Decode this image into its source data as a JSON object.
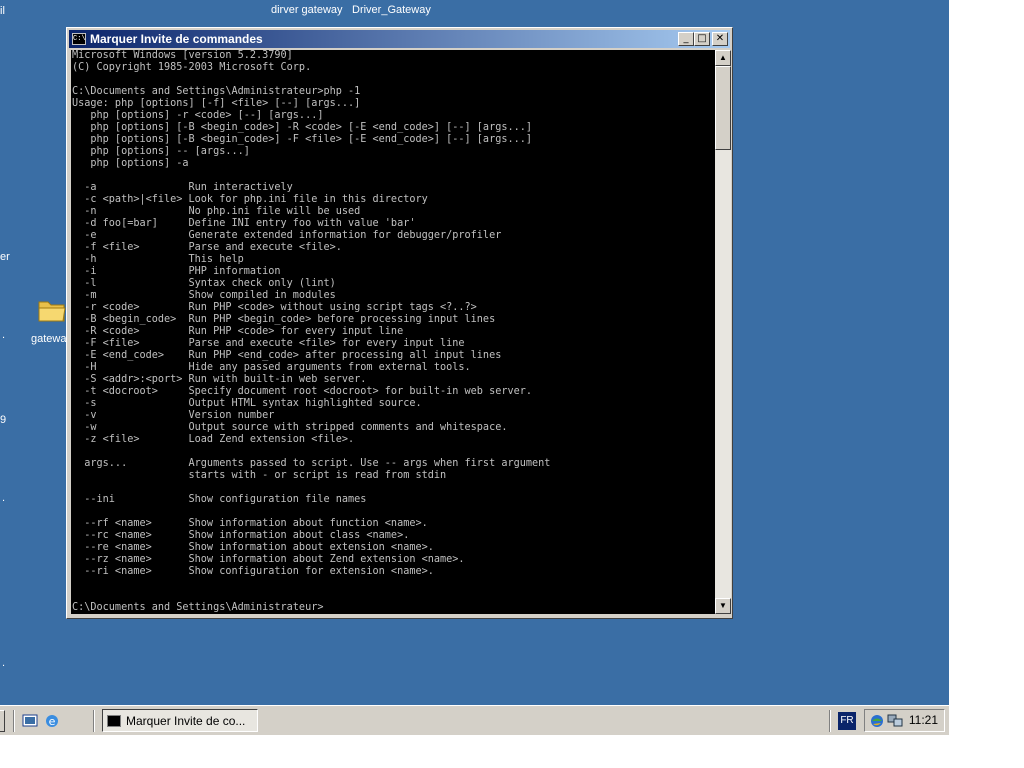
{
  "desktop": {
    "top_labels": [
      "dirver gateway",
      "Driver_Gateway"
    ],
    "edge_labels": [
      "il",
      "er",
      ".",
      "9",
      ".",
      "."
    ],
    "folder_label": "gatewa",
    "background_color": "#3a6ea5"
  },
  "window": {
    "title": "Marquer Invite de commandes",
    "icon_text": "C:\\",
    "buttons": {
      "minimize": "_",
      "maximize": "□",
      "close": "✕"
    },
    "console_lines": [
      "Microsoft Windows [version 5.2.3790]",
      "(C) Copyright 1985-2003 Microsoft Corp.",
      "",
      "C:\\Documents and Settings\\Administrateur>php -1",
      "Usage: php [options] [-f] <file> [--] [args...]",
      "   php [options] -r <code> [--] [args...]",
      "   php [options] [-B <begin_code>] -R <code> [-E <end_code>] [--] [args...]",
      "   php [options] [-B <begin_code>] -F <file> [-E <end_code>] [--] [args...]",
      "   php [options] -- [args...]",
      "   php [options] -a",
      "",
      "  -a               Run interactively",
      "  -c <path>|<file> Look for php.ini file in this directory",
      "  -n               No php.ini file will be used",
      "  -d foo[=bar]     Define INI entry foo with value 'bar'",
      "  -e               Generate extended information for debugger/profiler",
      "  -f <file>        Parse and execute <file>.",
      "  -h               This help",
      "  -i               PHP information",
      "  -l               Syntax check only (lint)",
      "  -m               Show compiled in modules",
      "  -r <code>        Run PHP <code> without using script tags <?..?>",
      "  -B <begin_code>  Run PHP <begin_code> before processing input lines",
      "  -R <code>        Run PHP <code> for every input line",
      "  -F <file>        Parse and execute <file> for every input line",
      "  -E <end_code>    Run PHP <end_code> after processing all input lines",
      "  -H               Hide any passed arguments from external tools.",
      "  -S <addr>:<port> Run with built-in web server.",
      "  -t <docroot>     Specify document root <docroot> for built-in web server.",
      "  -s               Output HTML syntax highlighted source.",
      "  -v               Version number",
      "  -w               Output source with stripped comments and whitespace.",
      "  -z <file>        Load Zend extension <file>.",
      "",
      "  args...          Arguments passed to script. Use -- args when first argument",
      "                   starts with - or script is read from stdin",
      "",
      "  --ini            Show configuration file names",
      "",
      "  --rf <name>      Show information about function <name>.",
      "  --rc <name>      Show information about class <name>.",
      "  --re <name>      Show information about extension <name>.",
      "  --rz <name>      Show information about Zend extension <name>.",
      "  --ri <name>      Show configuration for extension <name>.",
      "",
      "",
      "C:\\Documents and Settings\\Administrateur>"
    ],
    "scroll_up": "▲",
    "scroll_down": "▼"
  },
  "taskbar": {
    "task_button_label": "Marquer Invite de co...",
    "language": "FR",
    "clock": "11:21"
  }
}
